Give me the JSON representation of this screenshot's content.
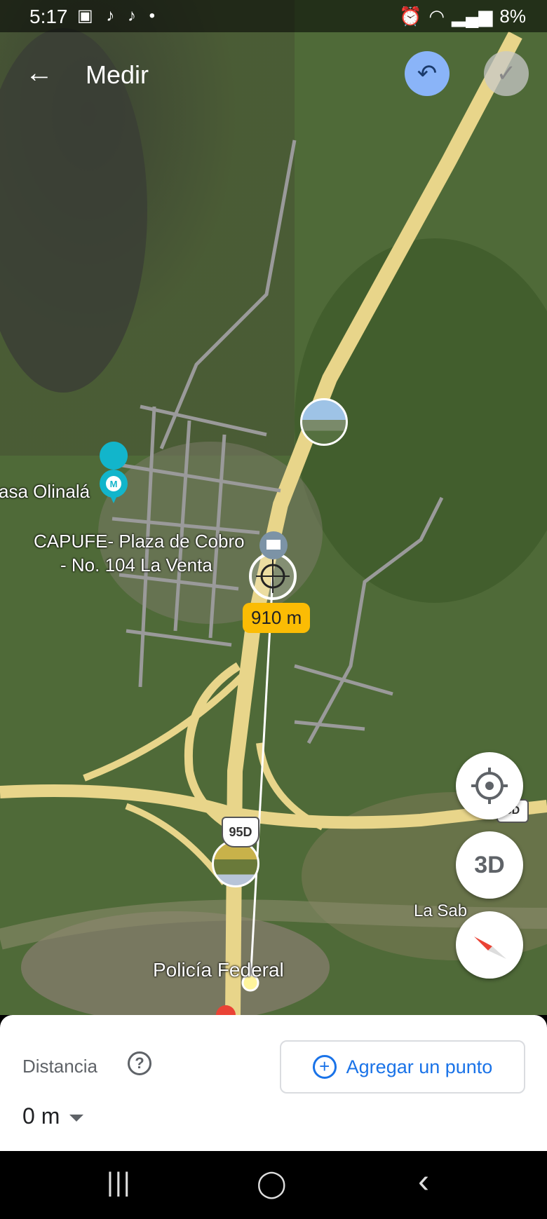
{
  "status_bar": {
    "time": "5:17",
    "left_icons": [
      "image-icon",
      "tiktok-icon",
      "tiktok-icon",
      "dot-icon"
    ],
    "left_icon_glyphs": "▣ ♪ ♪ •",
    "right_icons": [
      "alarm-icon",
      "wifi-icon",
      "wifi-call-icon",
      "signal-icon",
      "signal-icon"
    ],
    "battery": "8%"
  },
  "topbar": {
    "back_glyph": "←",
    "title": "Medir",
    "undo_glyph": "↶",
    "confirm_glyph": "✓"
  },
  "map": {
    "labels": {
      "place_1": "asa Olinalá",
      "place_2_line1": "CAPUFE- Plaza de Cobro",
      "place_2_line2": "- No. 104 La Venta",
      "place_3": "Policía Federal",
      "place_4": "La Sab"
    },
    "measured_distance_tag": "910 m",
    "road_shield": "95D",
    "road_shield_right": "5D",
    "fab_3d_label": "3D"
  },
  "bottom_sheet": {
    "distance_label": "Distancia",
    "help_glyph": "?",
    "add_point_label": "Agregar un punto",
    "add_glyph": "+",
    "distance_value": "0 m"
  },
  "nav_bar": {
    "recents": "|||",
    "home": "◯",
    "back": "‹"
  }
}
